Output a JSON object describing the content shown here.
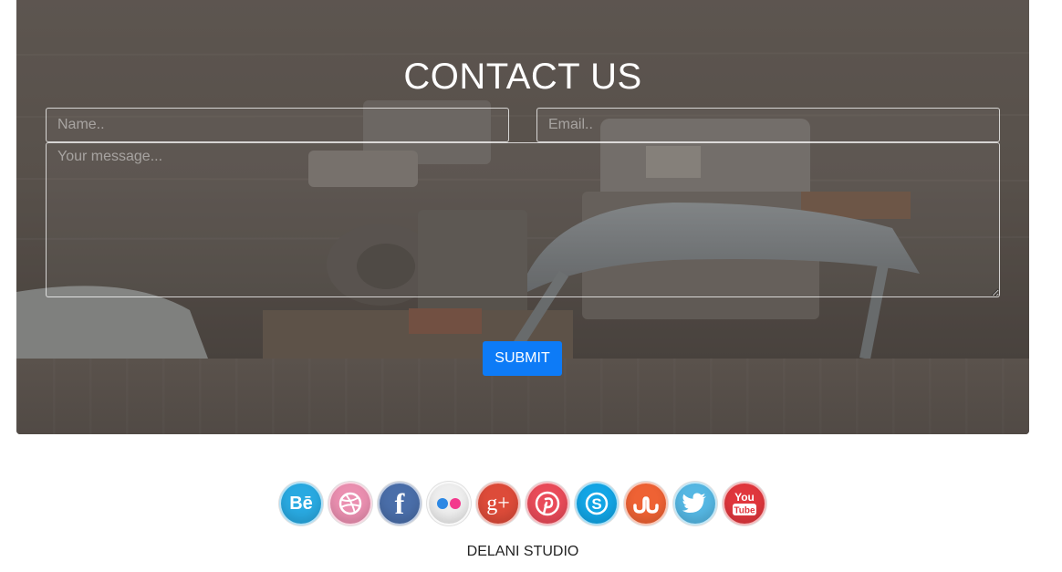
{
  "contact": {
    "title": "CONTACT US",
    "name_placeholder": "Name..",
    "email_placeholder": "Email..",
    "message_placeholder": "Your message...",
    "submit_label": "SUBMIT"
  },
  "social": {
    "icons": [
      {
        "name": "behance-icon",
        "color": "#29a9e1",
        "glyph": "Bē"
      },
      {
        "name": "dribbble-icon",
        "color": "#ea8fb0",
        "glyph": ""
      },
      {
        "name": "facebook-icon",
        "color": "#4a6ea9",
        "glyph": "f"
      },
      {
        "name": "flickr-icon",
        "color": "#eeeeee",
        "glyph": ""
      },
      {
        "name": "google-plus-icon",
        "color": "#dd4b39",
        "glyph": "g+"
      },
      {
        "name": "pinterest-icon",
        "color": "#e94b59",
        "glyph": ""
      },
      {
        "name": "skype-icon",
        "color": "#12a5e5",
        "glyph": "S"
      },
      {
        "name": "stumbleupon-icon",
        "color": "#ee6234",
        "glyph": ""
      },
      {
        "name": "twitter-icon",
        "color": "#55b7e3",
        "glyph": ""
      },
      {
        "name": "youtube-icon",
        "color": "#e0373d",
        "glyph": "You Tube"
      }
    ]
  },
  "footer": {
    "text": "DELANI STUDIO"
  }
}
